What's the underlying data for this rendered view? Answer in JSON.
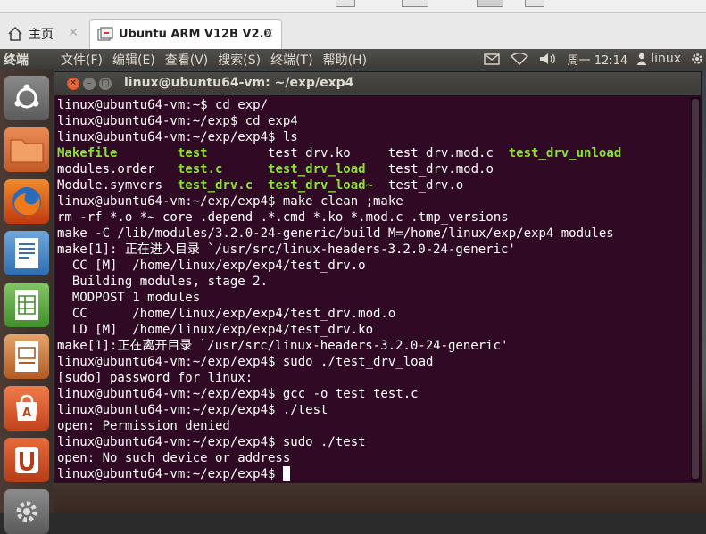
{
  "host_tabs": [
    {
      "label": "主页",
      "icon": "home-icon"
    },
    {
      "label": "Ubuntu ARM V12B V2.0",
      "icon": "vm-icon"
    }
  ],
  "ubuntu_panel": {
    "app_name": "终端",
    "menus": [
      "文件(F)",
      "编辑(E)",
      "查看(V)",
      "搜索(S)",
      "终端(T)",
      "帮助(H)"
    ],
    "clock": "周一 12:14",
    "user": "linux"
  },
  "launcher_icons": [
    "ubuntu-dash-icon",
    "files-folder-icon",
    "firefox-icon",
    "writer-icon",
    "calc-icon",
    "impress-icon",
    "software-center-icon",
    "ubuntu-one-icon",
    "settings-icon"
  ],
  "terminal": {
    "title": "linux@ubuntu64-vm: ~/exp/exp4",
    "lines": [
      [
        {
          "t": "linux@ubuntu64-vm:~$ cd exp/"
        }
      ],
      [
        {
          "t": "linux@ubuntu64-vm:~/exp$ cd exp4"
        }
      ],
      [
        {
          "t": "linux@ubuntu64-vm:~/exp/exp4$ ls"
        }
      ],
      [
        {
          "t": "Makefile",
          "c": "exe"
        },
        {
          "t": "        "
        },
        {
          "t": "test",
          "c": "exe"
        },
        {
          "t": "        test_drv.ko     test_drv.mod.c  "
        },
        {
          "t": "test_drv_unload",
          "c": "exe"
        }
      ],
      [
        {
          "t": "modules.order   "
        },
        {
          "t": "test.c",
          "c": "exe"
        },
        {
          "t": "      "
        },
        {
          "t": "test_drv_load",
          "c": "exe"
        },
        {
          "t": "   test_drv.mod.o"
        }
      ],
      [
        {
          "t": "Module.symvers  "
        },
        {
          "t": "test_drv.c",
          "c": "exe"
        },
        {
          "t": "  "
        },
        {
          "t": "test_drv_load~",
          "c": "exe"
        },
        {
          "t": "  test_drv.o"
        }
      ],
      [
        {
          "t": "linux@ubuntu64-vm:~/exp/exp4$ make clean ;make"
        }
      ],
      [
        {
          "t": "rm -rf *.o *~ core .depend .*.cmd *.ko *.mod.c .tmp_versions"
        }
      ],
      [
        {
          "t": "make -C /lib/modules/3.2.0-24-generic/build M=/home/linux/exp/exp4 modules"
        }
      ],
      [
        {
          "t": "make[1]: 正在进入目录 `/usr/src/linux-headers-3.2.0-24-generic'"
        }
      ],
      [
        {
          "t": "  CC [M]  /home/linux/exp/exp4/test_drv.o"
        }
      ],
      [
        {
          "t": "  Building modules, stage 2."
        }
      ],
      [
        {
          "t": "  MODPOST 1 modules"
        }
      ],
      [
        {
          "t": "  CC      /home/linux/exp/exp4/test_drv.mod.o"
        }
      ],
      [
        {
          "t": "  LD [M]  /home/linux/exp/exp4/test_drv.ko"
        }
      ],
      [
        {
          "t": "make[1]:正在离开目录 `/usr/src/linux-headers-3.2.0-24-generic'"
        }
      ],
      [
        {
          "t": "linux@ubuntu64-vm:~/exp/exp4$ sudo ./test_drv_load"
        }
      ],
      [
        {
          "t": "[sudo] password for linux:"
        }
      ],
      [
        {
          "t": "linux@ubuntu64-vm:~/exp/exp4$ gcc -o test test.c"
        }
      ],
      [
        {
          "t": "linux@ubuntu64-vm:~/exp/exp4$ ./test"
        }
      ],
      [
        {
          "t": "open: Permission denied"
        }
      ],
      [
        {
          "t": "linux@ubuntu64-vm:~/exp/exp4$ sudo ./test"
        }
      ],
      [
        {
          "t": "open: No such device or address"
        }
      ],
      [
        {
          "t": "linux@ubuntu64-vm:~/exp/exp4$ "
        }
      ]
    ]
  },
  "colors": {
    "terminal_bg": "#300a24",
    "executable_green": "#8ae234",
    "panel_bg": "#3c3b37",
    "close_button": "#e0562a"
  }
}
